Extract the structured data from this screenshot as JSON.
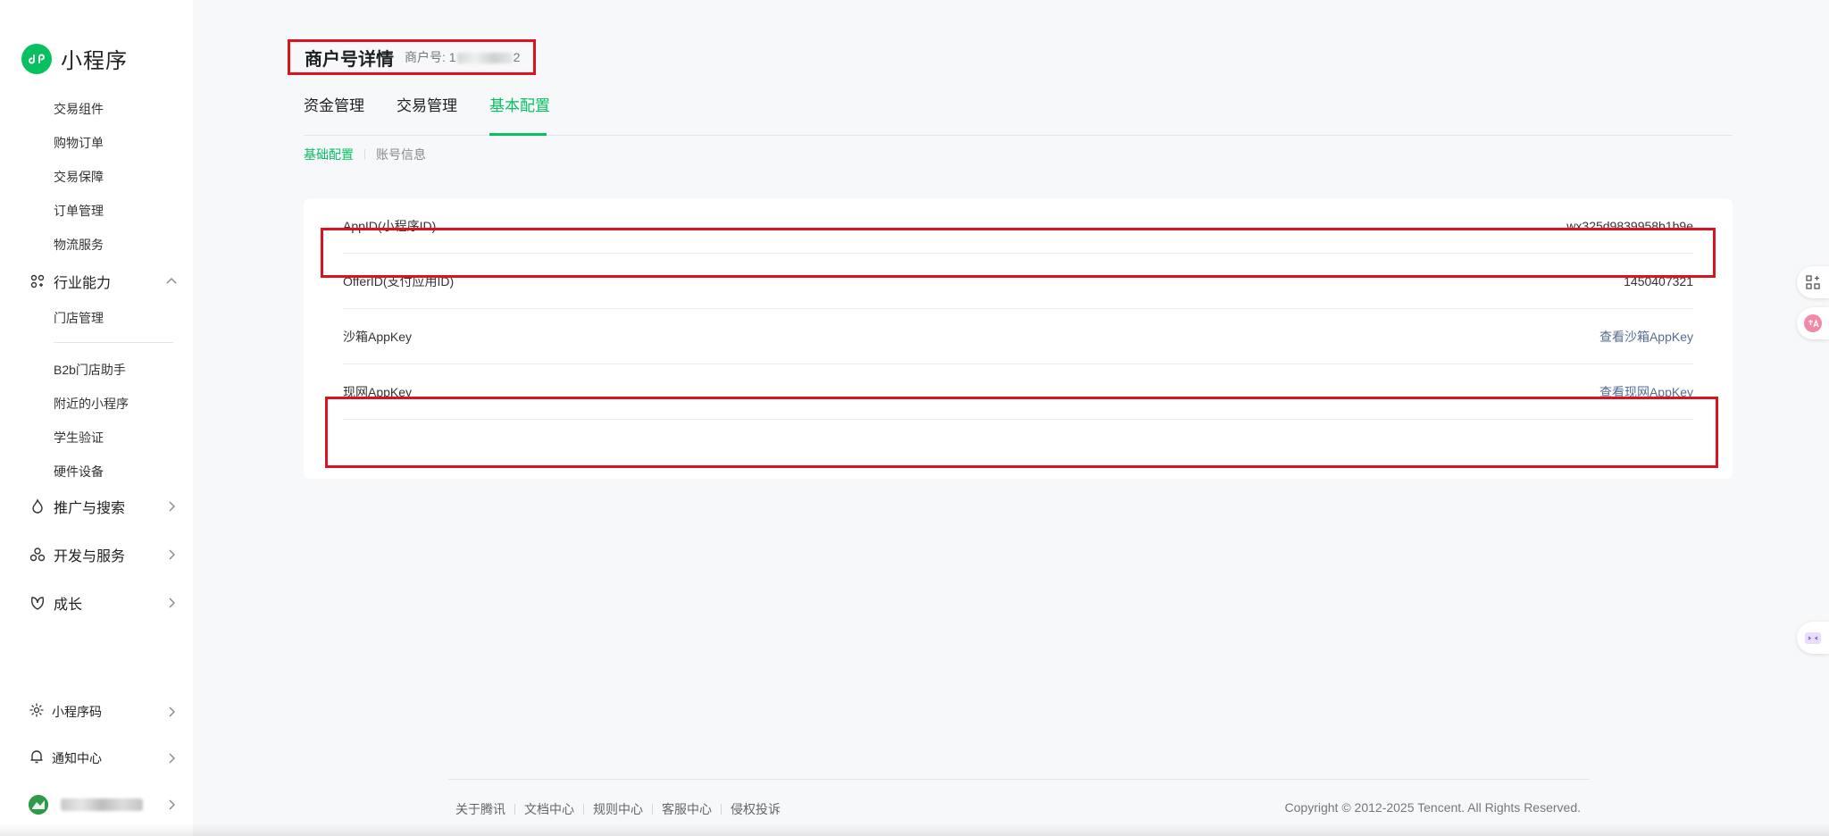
{
  "app": {
    "logo_text": "小程序"
  },
  "sidebar": {
    "sub_items_top": [
      "交易组件",
      "购物订单",
      "交易保障",
      "订单管理",
      "物流服务"
    ],
    "group_industry": "行业能力",
    "industry_items": [
      "门店管理"
    ],
    "industry_items_2": [
      "B2b门店助手",
      "附近的小程序",
      "学生验证",
      "硬件设备"
    ],
    "group_promotion": "推广与搜索",
    "group_dev": "开发与服务",
    "group_growth": "成长",
    "bottom_qrcode": "小程序码",
    "bottom_notify": "通知中心"
  },
  "header": {
    "title": "商户号详情",
    "merchant_prefix": "商户号: 1",
    "merchant_suffix": "2"
  },
  "tabs": [
    {
      "label": "资金管理",
      "active": false
    },
    {
      "label": "交易管理",
      "active": false
    },
    {
      "label": "基本配置",
      "active": true
    }
  ],
  "subtabs": [
    {
      "label": "基础配置",
      "active": true
    },
    {
      "label": "账号信息",
      "active": false
    }
  ],
  "card": {
    "rows": [
      {
        "label": "AppID(小程序ID)",
        "value": "wx325d9839958b1b9e"
      },
      {
        "label": "OfferID(支付应用ID)",
        "value": "1450407321"
      },
      {
        "label": "沙箱AppKey",
        "link": "查看沙箱AppKey"
      },
      {
        "label": "现网AppKey",
        "link": "查看现网AppKey"
      }
    ]
  },
  "footer": {
    "links": [
      "关于腾讯",
      "文档中心",
      "规则中心",
      "客服中心",
      "侵权投诉"
    ],
    "copyright": "Copyright © 2012-2025 Tencent. All Rights Reserved."
  },
  "colors": {
    "accent": "#07c160",
    "highlight": "#d9141f",
    "link": "#576b95"
  }
}
